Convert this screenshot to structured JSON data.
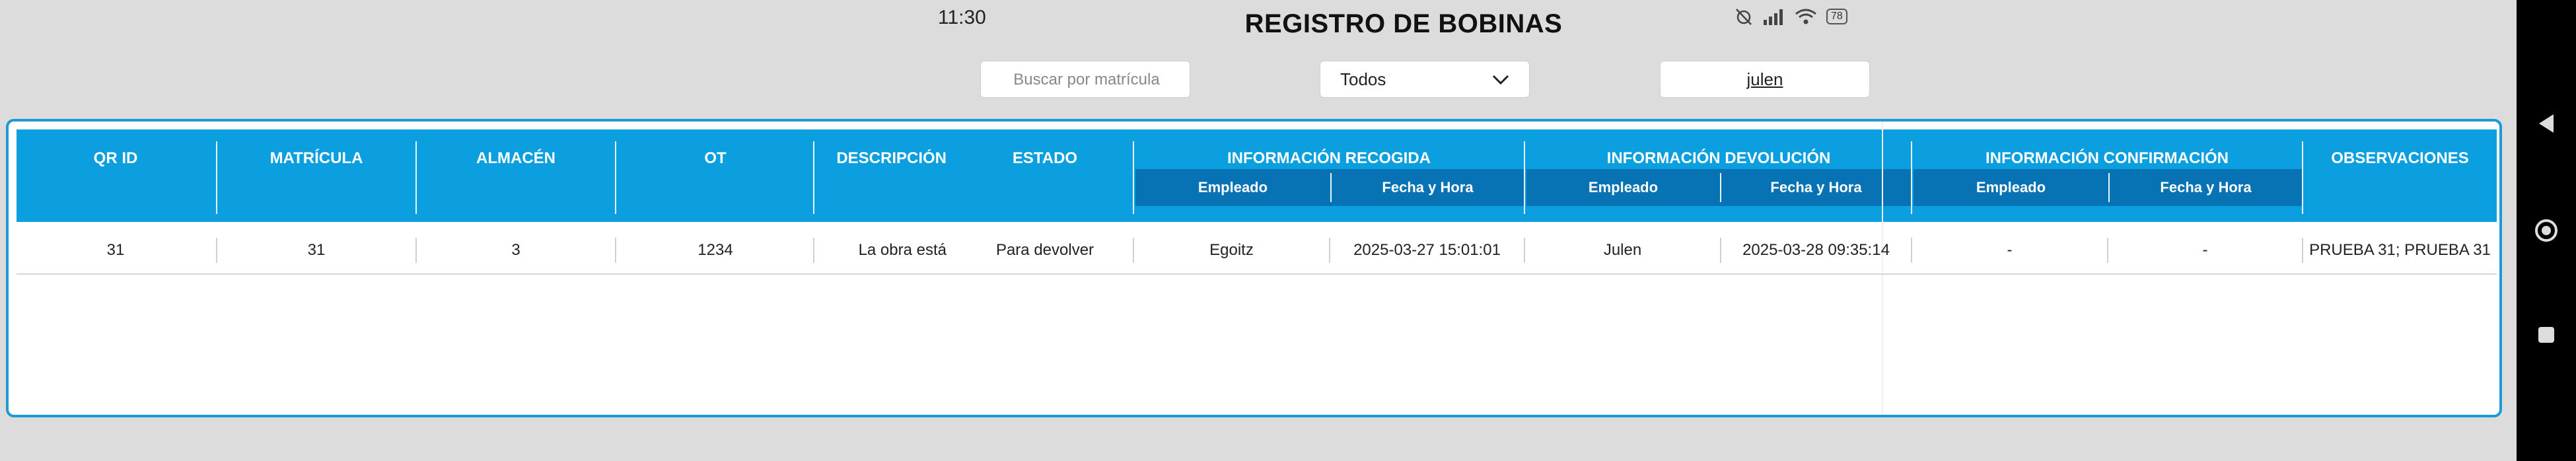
{
  "status_bar": {
    "time": "11:30",
    "battery": "78"
  },
  "header": {
    "title": "REGISTRO DE BOBINAS"
  },
  "filters": {
    "search_placeholder": "Buscar por matrícula",
    "status_select": "Todos",
    "user": "julen"
  },
  "table": {
    "columns": {
      "qr_id": "QR ID",
      "matricula": "MATRÍCULA",
      "almacen": "ALMACÉN",
      "ot": "OT",
      "descripcion": "DESCRIPCIÓN",
      "estado": "ESTADO",
      "recogida": "INFORMACIÓN RECOGIDA",
      "devolucion": "INFORMACIÓN DEVOLUCIÓN",
      "confirmacion": "INFORMACIÓN CONFIRMACIÓN",
      "observaciones": "OBSERVACIONES",
      "empleado": "Empleado",
      "fecha_hora": "Fecha y Hora"
    },
    "rows": [
      {
        "qr_id": "31",
        "matricula": "31",
        "almacen": "3",
        "ot": "1234",
        "descripcion": "La obra está",
        "estado": "Para devolver",
        "recogida_empleado": "Egoitz",
        "recogida_fecha": "2025-03-27 15:01:01",
        "devolucion_empleado": "Julen",
        "devolucion_fecha": "2025-03-28 09:35:14",
        "confirmacion_empleado": "-",
        "confirmacion_fecha": "-",
        "observaciones": "PRUEBA 31; PRUEBA 31"
      }
    ]
  },
  "colors": {
    "header_bg": "#0b9fe0",
    "subheader_bg": "#0873b4",
    "border": "#1a9bd7"
  }
}
